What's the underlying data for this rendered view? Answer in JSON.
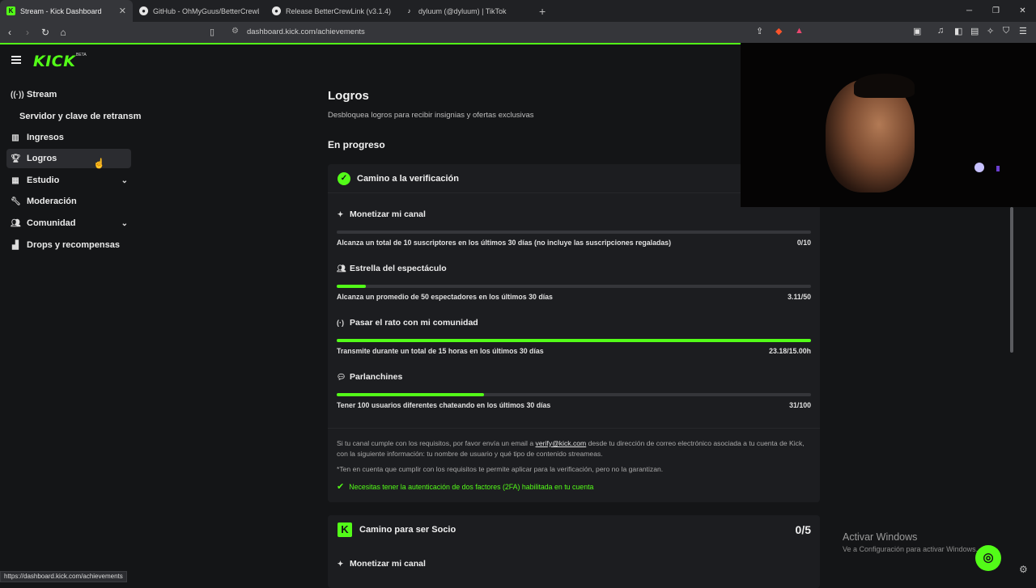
{
  "browser": {
    "tabs": [
      {
        "title": "Stream - Kick Dashboard",
        "favicon": "kick-icon",
        "active": true
      },
      {
        "title": "GitHub - OhMyGuus/BetterCrewLink",
        "favicon": "github-icon",
        "active": false
      },
      {
        "title": "Release BetterCrewLink (v3.1.4) - Oh",
        "favicon": "github-icon",
        "active": false
      },
      {
        "title": "dyluum (@dyluum) | TikTok",
        "favicon": "tiktok-icon",
        "active": false
      }
    ],
    "url": "dashboard.kick.com/achievements",
    "status_url": "https://dashboard.kick.com/achievements",
    "shield_badge": "0",
    "alert_badge": "1"
  },
  "app": {
    "logo": "KICK",
    "beta": "BETA"
  },
  "sidebar": {
    "items": [
      {
        "label": "Stream",
        "icon": "broadcast-icon",
        "selected": false,
        "expandable": false
      },
      {
        "label": "Servidor y clave de retransm",
        "icon": "",
        "selected": false,
        "expandable": false
      },
      {
        "label": "Ingresos",
        "icon": "chart-icon",
        "selected": false,
        "expandable": false
      },
      {
        "label": "Logros",
        "icon": "trophy-icon",
        "selected": true,
        "expandable": false
      },
      {
        "label": "Estudio",
        "icon": "studio-icon",
        "selected": false,
        "expandable": true
      },
      {
        "label": "Moderación",
        "icon": "wrench-icon",
        "selected": false,
        "expandable": false
      },
      {
        "label": "Comunidad",
        "icon": "community-icon",
        "selected": false,
        "expandable": true
      },
      {
        "label": "Drops y recompensas",
        "icon": "gift-icon",
        "selected": false,
        "expandable": false
      }
    ]
  },
  "main": {
    "title": "Logros",
    "subtitle": "Desbloquea logros para recibir insignias y ofertas exclusivas",
    "section": "En progreso",
    "verification": {
      "title": "Camino a la verificación",
      "requirements": [
        {
          "title": "Monetizar mi canal",
          "desc": "Alcanza un total de 10 suscriptores en los últimos 30 días (no incluye las suscripciones regaladas)",
          "value": "0/10",
          "progress": 0.0
        },
        {
          "title": "Estrella del espectáculo",
          "desc": "Alcanza un promedio de 50 espectadores en los últimos 30 días",
          "value": "3.11/50",
          "progress": 0.062
        },
        {
          "title": "Pasar el rato con mi comunidad",
          "desc": "Transmite durante un total de 15 horas en los últimos 30 días",
          "value": "23.18/15.00h",
          "progress": 1.0
        },
        {
          "title": "Parlanchines",
          "desc": "Tener 100 usuarios diferentes chateando en los últimos 30 días",
          "value": "31/100",
          "progress": 0.31
        }
      ],
      "note_pre": "Si tu canal cumple con los requisitos, por favor envía un email a ",
      "note_link": "verify@kick.com",
      "note_post": " desde tu dirección de correo electrónico asociada a tu cuenta de Kick, con la siguiente información: tu nombre de usuario y qué tipo de contenido streameas.",
      "disclaimer": "*Ten en cuenta que cumplir con los requisitos te permite aplicar para la verificación, pero no la garantizan.",
      "twofa": "Necesitas tener la autenticación de dos factores (2FA) habilitada en tu cuenta"
    },
    "partner": {
      "title": "Camino para ser Socio",
      "count": "0/5",
      "first_req": "Monetizar mi canal"
    }
  },
  "overlay": {
    "watermark_title": "Activar Windows",
    "watermark_sub": "Ve a Configuración para activar Windows."
  },
  "colors": {
    "accent": "#53fc18",
    "bg": "#141517",
    "card": "#1c1d20"
  }
}
